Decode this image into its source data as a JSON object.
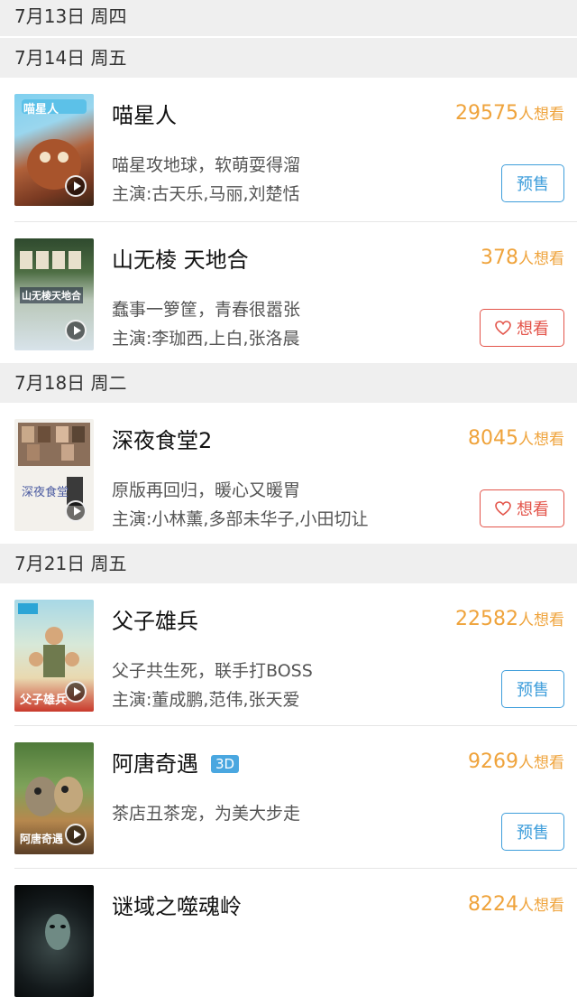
{
  "sections": [
    {
      "date": "7月13日 周四"
    },
    {
      "date": "7月14日 周五"
    },
    {
      "date": "7月18日 周二"
    },
    {
      "date": "7月21日 周五"
    }
  ],
  "movies": [
    {
      "title": "喵星人",
      "want_count": "29575",
      "want_suffix": "人想看",
      "desc": "喵星攻地球，软萌耍得溜",
      "cast": "主演:古天乐,马丽,刘楚恬",
      "button": "预售",
      "poster_text": "喵星人"
    },
    {
      "title": "山无棱 天地合",
      "want_count": "378",
      "want_suffix": "人想看",
      "desc": "蠢事一箩筐，青春很嚣张",
      "cast": "主演:李珈西,上白,张洛晨",
      "button": "想看",
      "poster_text": "山无棱天地合"
    },
    {
      "title": "深夜食堂2",
      "want_count": "8045",
      "want_suffix": "人想看",
      "desc": "原版再回归，暖心又暖胃",
      "cast": "主演:小林薰,多部未华子,小田切让",
      "button": "想看",
      "poster_text": "深夜食堂"
    },
    {
      "title": "父子雄兵",
      "want_count": "22582",
      "want_suffix": "人想看",
      "desc": "父子共生死，联手打BOSS",
      "cast": "主演:董成鹏,范伟,张天爱",
      "button": "预售",
      "poster_text": "父子雄兵"
    },
    {
      "title": "阿唐奇遇",
      "badge": "3D",
      "want_count": "9269",
      "want_suffix": "人想看",
      "desc": "茶店丑茶宠，为美大步走",
      "button": "预售",
      "poster_text": "阿唐奇遇"
    },
    {
      "title": "谜域之噬魂岭",
      "want_count": "8224",
      "want_suffix": "人想看"
    }
  ],
  "colors": {
    "want": "#efa33b",
    "presale": "#3f9edb",
    "wish": "#e3544a",
    "badge": "#4aa7e0",
    "header_bg": "#efefef"
  }
}
